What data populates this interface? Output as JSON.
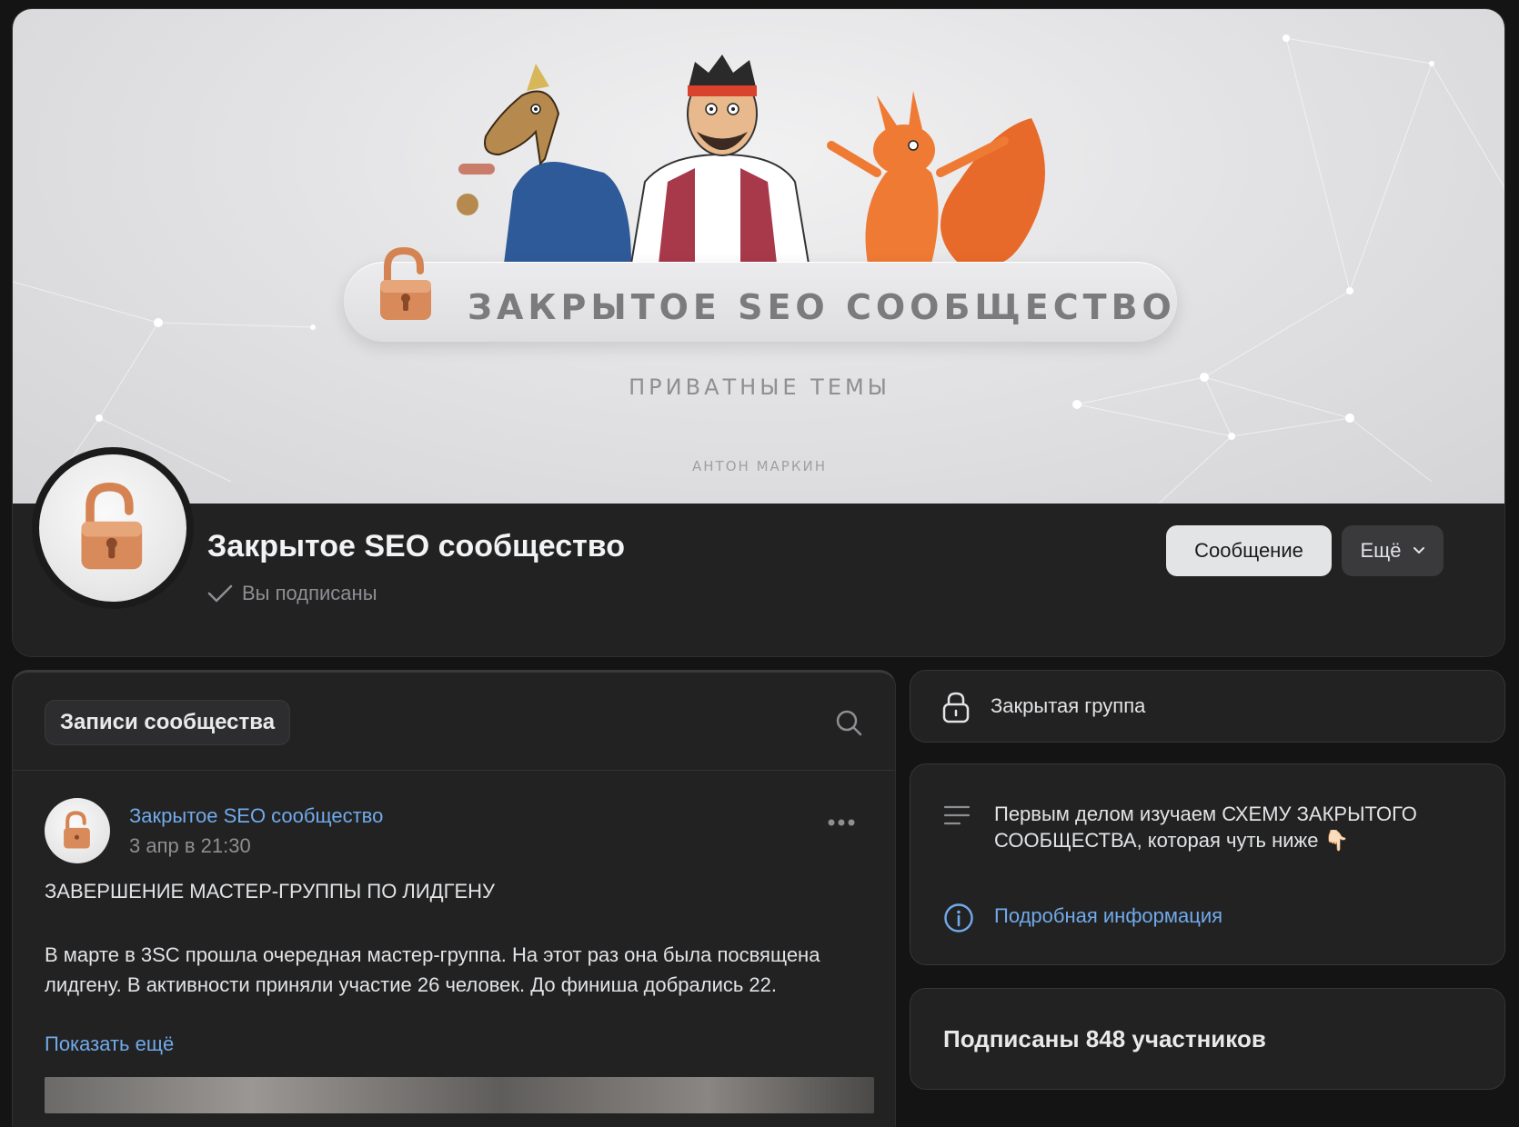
{
  "cover": {
    "title": "ЗАКРЫТОЕ SEO СООБЩЕСТВО",
    "subtitle": "ПРИВАТНЫЕ ТЕМЫ",
    "author": "АНТОН МАРКИН"
  },
  "header": {
    "group_name": "Закрытое SEO сообщество",
    "subscribed_label": "Вы подписаны",
    "message_button": "Сообщение",
    "more_button": "Ещё"
  },
  "feed": {
    "tab_label": "Записи сообщества",
    "post": {
      "author": "Закрытое SEO сообщество",
      "date": "3 апр в 21:30",
      "heading": "ЗАВЕРШЕНИЕ МАСТЕР-ГРУППЫ ПО ЛИДГЕНУ",
      "body": "В марте в 3SC прошла очередная мастер-группа. На этот раз она была посвящена лидгену. В активности приняли участие 26 человек. До финиша добрались 22.",
      "show_more": "Показать ещё"
    }
  },
  "sidebar": {
    "group_type": "Закрытая группа",
    "description": "Первым делом изучаем СХЕМУ ЗАКРЫТОГО СООБЩЕСТВА, которая чуть ниже 👇🏻",
    "info_link": "Подробная информация",
    "members": "Подписаны 848 участников"
  },
  "colors": {
    "background": "#141414",
    "card": "#222222",
    "link": "#71aaeb",
    "secondary_text": "#8d8f93",
    "lock_orange": "#d98a5a"
  },
  "icons": [
    "lock-icon",
    "check-icon",
    "chevron-down-icon",
    "search-icon",
    "more-dots-icon",
    "text-lines-icon",
    "info-icon"
  ]
}
